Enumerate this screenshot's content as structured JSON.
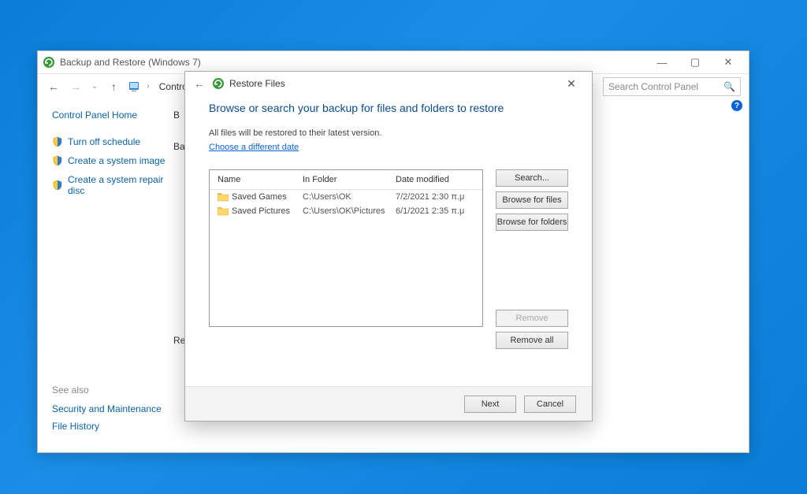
{
  "window": {
    "title": "Backup and Restore (Windows 7)",
    "breadcrumb": [
      "Control Panel"
    ],
    "search_placeholder": "Search Control Panel"
  },
  "sidebar": {
    "home": "Control Panel Home",
    "items": [
      {
        "label": "Turn off schedule"
      },
      {
        "label": "Create a system image"
      },
      {
        "label": "Create a system repair disc"
      }
    ],
    "see_also_header": "See also",
    "see_also": [
      "Security and Maintenance",
      "File History"
    ]
  },
  "hint_letters": {
    "top": "B",
    "mid": "Ba",
    "low": "Re"
  },
  "dialog": {
    "title": "Restore Files",
    "heading": "Browse or search your backup for files and folders to restore",
    "subtext": "All files will be restored to their latest version.",
    "link": "Choose a different date",
    "columns": {
      "name": "Name",
      "folder": "In Folder",
      "date": "Date modified"
    },
    "rows": [
      {
        "name": "Saved Games",
        "folder": "C:\\Users\\OK",
        "date": "7/2/2021 2:30 π.μ"
      },
      {
        "name": "Saved Pictures",
        "folder": "C:\\Users\\OK\\Pictures",
        "date": "6/1/2021 2:35 π.μ"
      }
    ],
    "buttons": {
      "search": "Search...",
      "browse_files": "Browse for files",
      "browse_folders": "Browse for folders",
      "remove": "Remove",
      "remove_all": "Remove all",
      "next": "Next",
      "cancel": "Cancel"
    }
  }
}
